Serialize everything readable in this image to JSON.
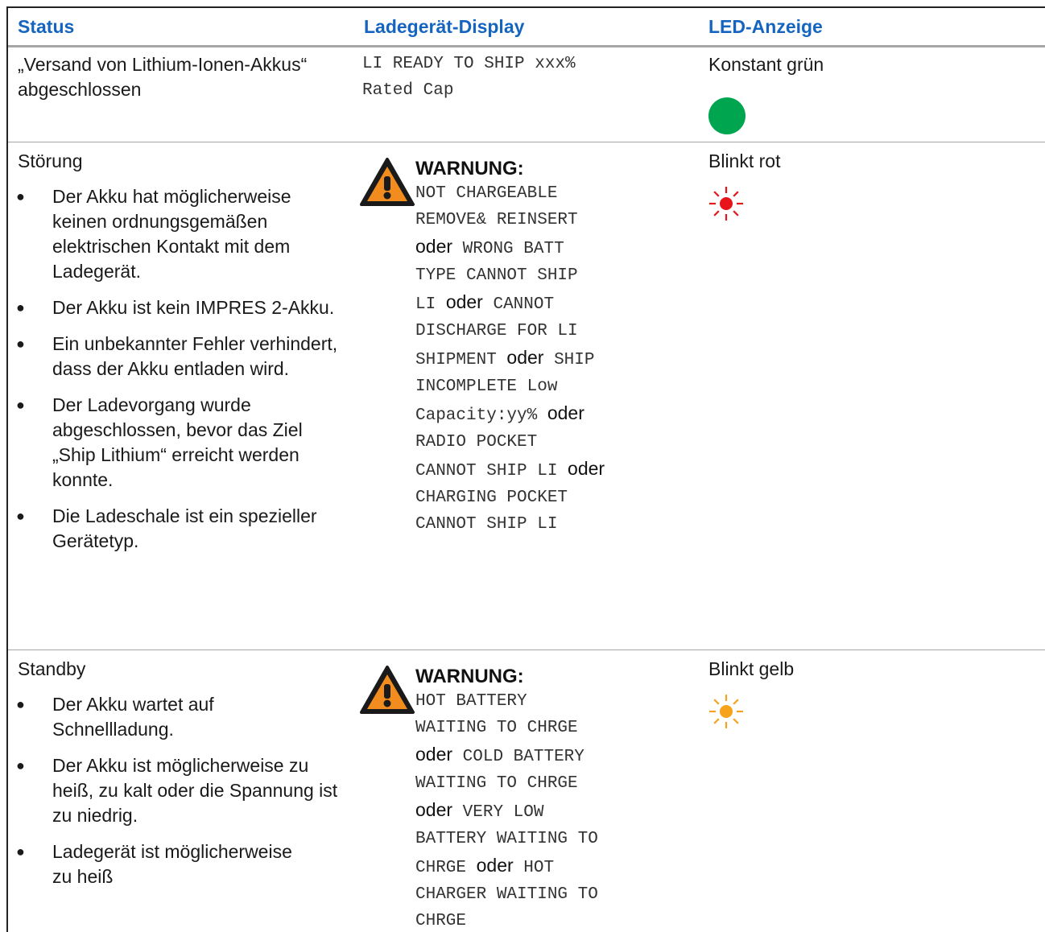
{
  "header": {
    "status": "Status",
    "display": "Ladegerät-Display",
    "led": "LED-Anzeige"
  },
  "row1": {
    "status": "„Versand von Lithium-Ionen-Akkus“ abgeschlossen",
    "display_lines": [
      "LI READY TO SHIP xxx%",
      "Rated Cap"
    ],
    "led_label": "Konstant grün",
    "led_color": "#00a550"
  },
  "row2": {
    "status_title": "Störung",
    "bullets": [
      "Der Akku hat möglicherweise keinen ordnungsgemäßen elektrischen Kontakt mit dem Ladegerät.",
      "Der Akku ist kein IMPRES 2-Akku.",
      "Ein unbekannter Fehler verhindert, dass der Akku entladen wird.",
      "Der Ladevorgang wurde abgeschlossen, bevor das Ziel „Ship Lithium“ erreicht werden konnte.",
      "Die Ladeschale ist ein spezieller Gerätetyp."
    ],
    "warning_title": "WARNUNG:",
    "display_lines": [
      [
        {
          "t": "NOT CHARGEABLE"
        }
      ],
      [
        {
          "t": "REMOVE& REINSERT"
        }
      ],
      [
        {
          "o": "oder"
        },
        {
          "t": " WRONG BATT"
        }
      ],
      [
        {
          "t": "TYPE CANNOT SHIP"
        }
      ],
      [
        {
          "t": "LI "
        },
        {
          "o": "oder"
        },
        {
          "t": " CANNOT"
        }
      ],
      [
        {
          "t": "DISCHARGE FOR LI"
        }
      ],
      [
        {
          "t": "SHIPMENT "
        },
        {
          "o": "oder"
        },
        {
          "t": " SHIP"
        }
      ],
      [
        {
          "t": "INCOMPLETE Low"
        }
      ],
      [
        {
          "t": "Capacity:yy% "
        },
        {
          "o": "oder"
        }
      ],
      [
        {
          "t": "RADIO POCKET"
        }
      ],
      [
        {
          "t": "CANNOT SHIP LI "
        },
        {
          "o": "oder"
        }
      ],
      [
        {
          "t": "CHARGING POCKET"
        }
      ],
      [
        {
          "t": "CANNOT SHIP LI"
        }
      ]
    ],
    "led_label": "Blinkt rot",
    "led_color": "#e8141c"
  },
  "row3": {
    "status_title": "Standby",
    "bullets": [
      "Der Akku wartet auf Schnellladung.",
      "Der Akku ist möglicherweise zu heiß, zu kalt oder die Spannung ist zu niedrig.",
      "Ladegerät ist möglicherweise zu heiß"
    ],
    "warning_title": "WARNUNG:",
    "display_lines": [
      [
        {
          "t": "HOT BATTERY"
        }
      ],
      [
        {
          "t": "WAITING TO CHRGE"
        }
      ],
      [
        {
          "o": "oder"
        },
        {
          "t": " COLD BATTERY"
        }
      ],
      [
        {
          "t": "WAITING TO CHRGE"
        }
      ],
      [
        {
          "o": "oder"
        },
        {
          "t": " VERY LOW"
        }
      ],
      [
        {
          "t": "BATTERY WAITING TO"
        }
      ],
      [
        {
          "t": "CHRGE "
        },
        {
          "o": "oder"
        },
        {
          "t": " HOT"
        }
      ],
      [
        {
          "t": "CHARGER WAITING TO"
        }
      ],
      [
        {
          "t": "CHRGE"
        }
      ]
    ],
    "led_label": "Blinkt gelb",
    "led_color": "#f7a21b"
  },
  "icons": {
    "warning": "warning-triangle-icon",
    "led_solid": "led-solid-icon",
    "led_blink": "led-blinking-icon"
  }
}
